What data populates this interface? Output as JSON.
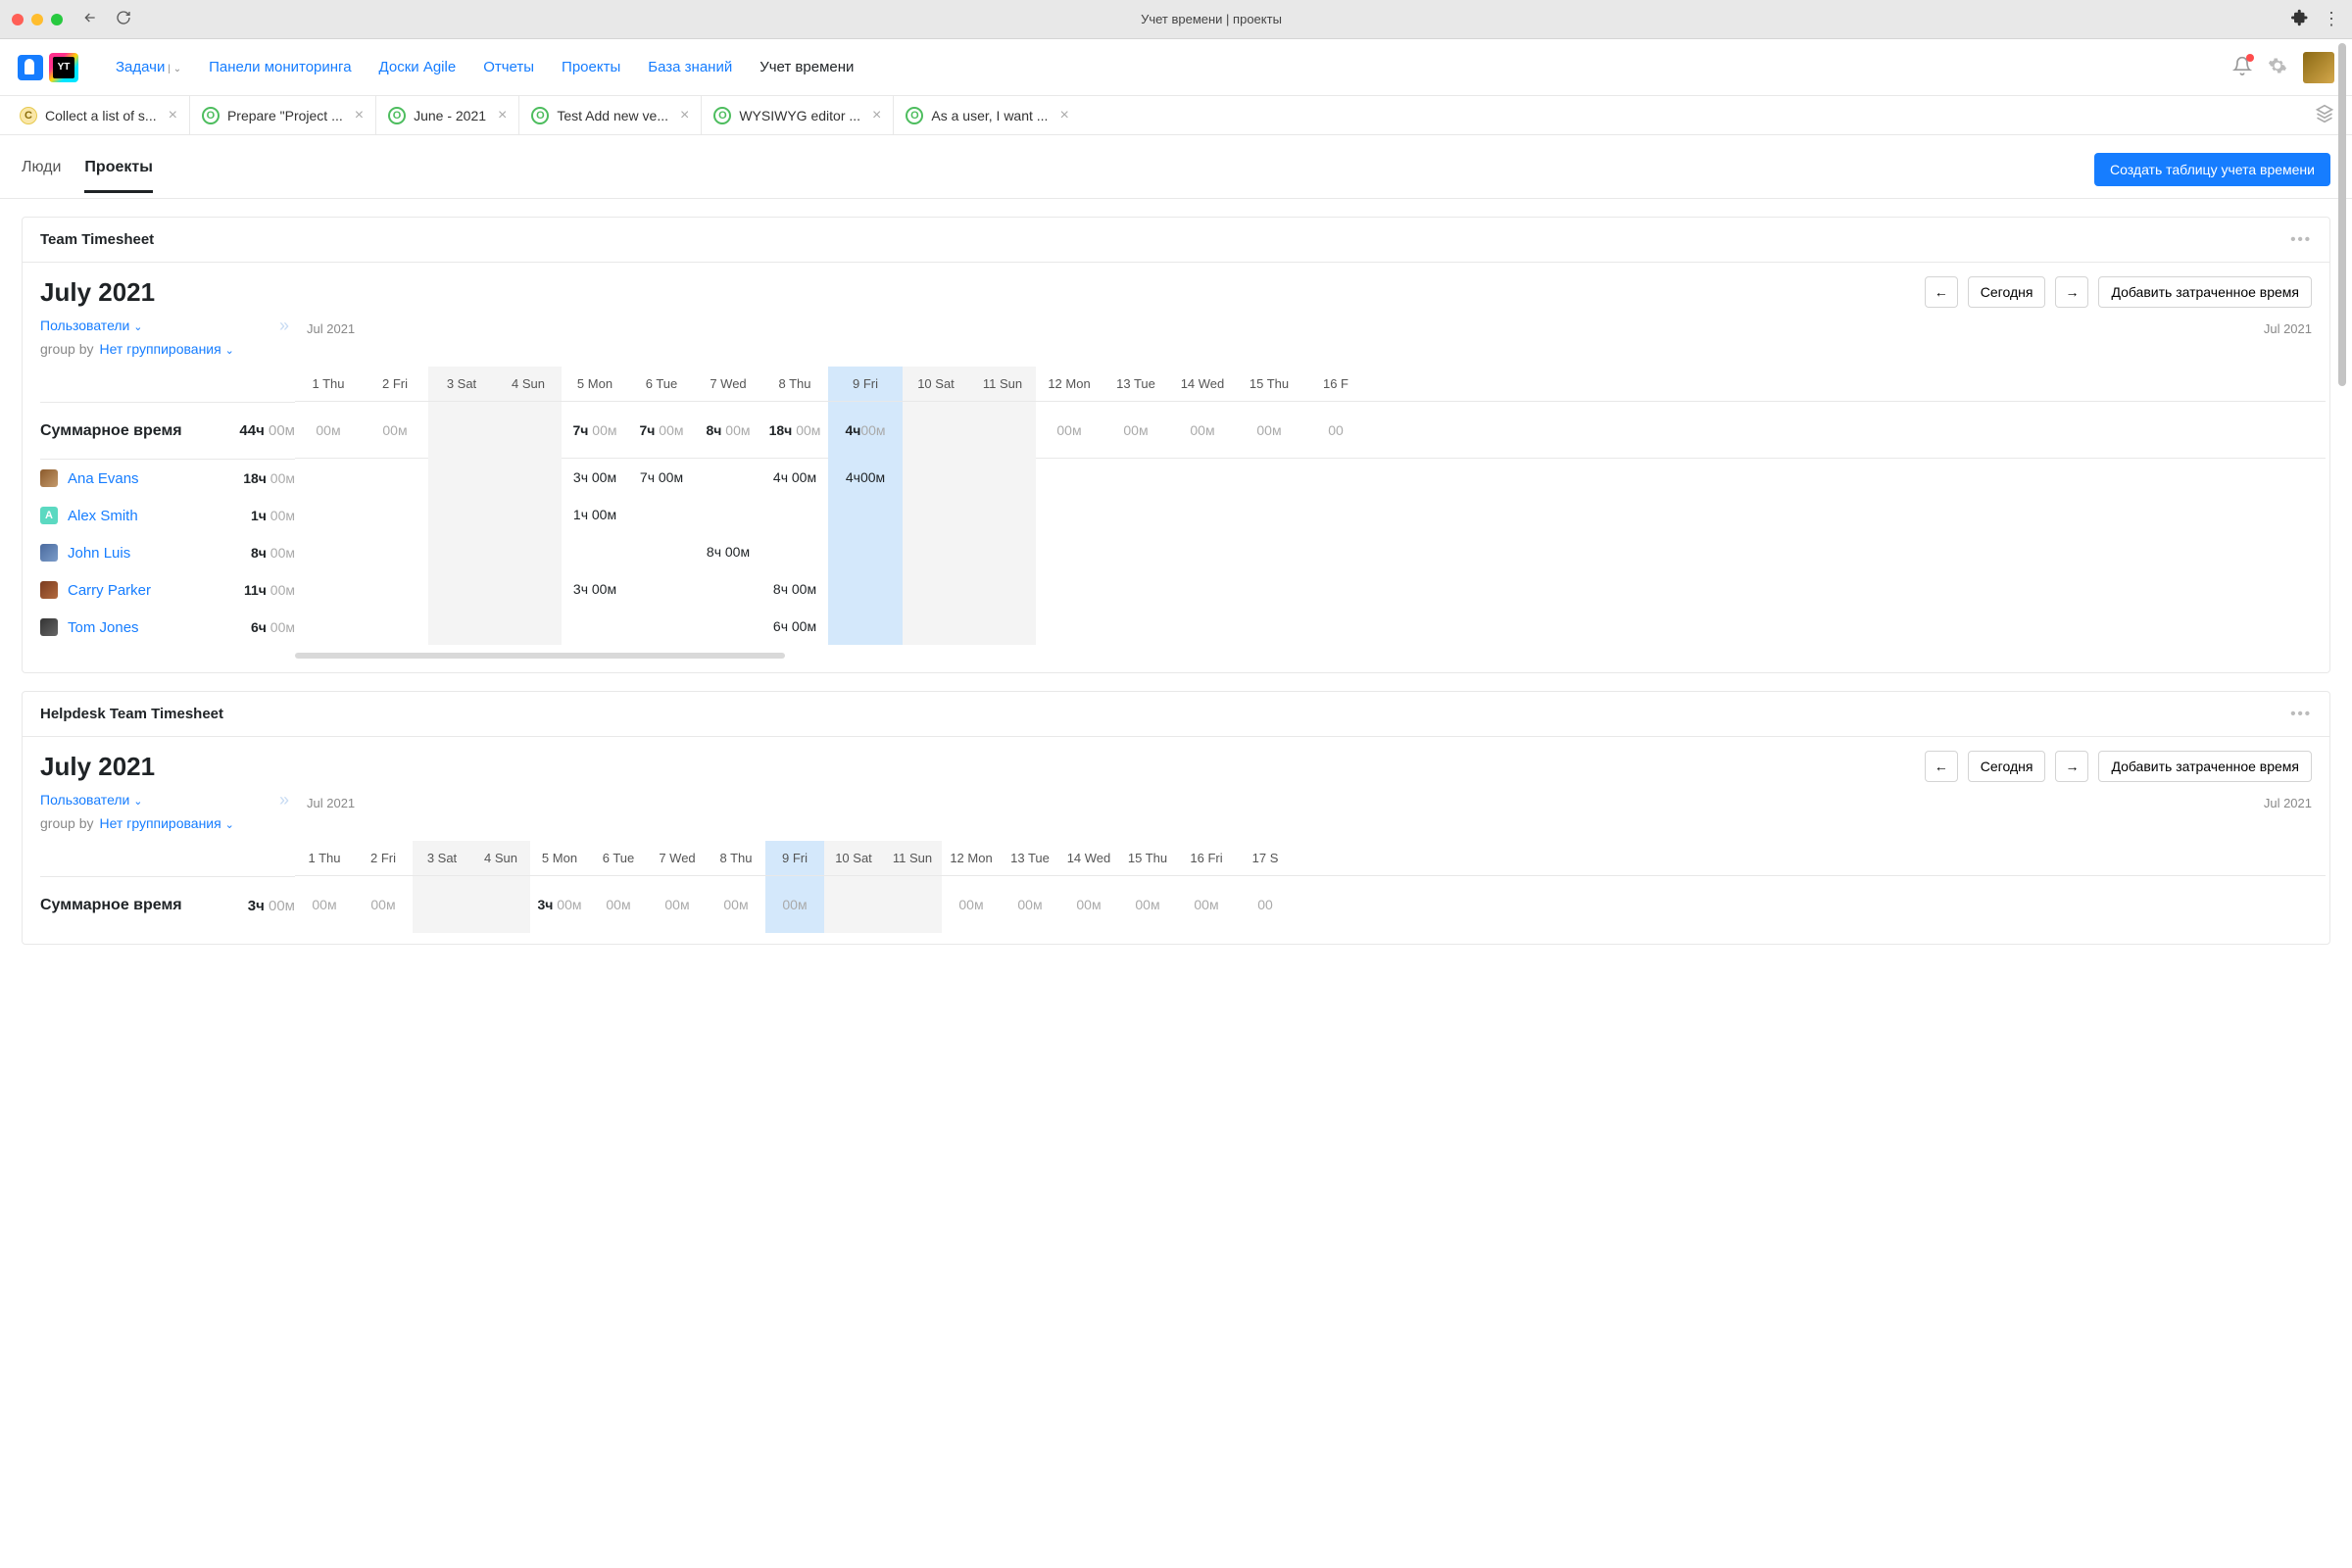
{
  "chrome": {
    "title": "Учет времени | проекты"
  },
  "nav": {
    "items": [
      {
        "label": "Задачи",
        "has_caret": true
      },
      {
        "label": "Панели мониторинга"
      },
      {
        "label": "Доски Agile"
      },
      {
        "label": "Отчеты"
      },
      {
        "label": "Проекты"
      },
      {
        "label": "База знаний"
      },
      {
        "label": "Учет времени",
        "active": true
      }
    ]
  },
  "logo_text": "YT",
  "breadcrumb_tabs": [
    {
      "icon": "C",
      "cls": "c",
      "label": "Collect a list of s..."
    },
    {
      "icon": "O",
      "cls": "o",
      "label": "Prepare \"Project ..."
    },
    {
      "icon": "O",
      "cls": "o",
      "label": "June - 2021"
    },
    {
      "icon": "O",
      "cls": "o",
      "label": "Test Add new ve..."
    },
    {
      "icon": "O",
      "cls": "o",
      "label": "WYSIWYG editor ..."
    },
    {
      "icon": "O",
      "cls": "o",
      "label": "As a user, I want ..."
    }
  ],
  "view_tabs": {
    "people": "Люди",
    "projects": "Проекты",
    "create_btn": "Создать таблицу учета времени"
  },
  "common": {
    "today": "Сегодня",
    "add_time": "Добавить затраченное время",
    "users": "Пользователи",
    "group_by": "group by",
    "no_grouping": "Нет группирования",
    "period_left": "Jul 2021",
    "period_right": "Jul 2021",
    "sum_label": "Суммарное время"
  },
  "panel1": {
    "name": "Team Timesheet",
    "month": "July 2021",
    "columns": [
      {
        "label": "1 Thu",
        "type": ""
      },
      {
        "label": "2 Fri",
        "type": ""
      },
      {
        "label": "3 Sat",
        "type": "we"
      },
      {
        "label": "4 Sun",
        "type": "we"
      },
      {
        "label": "5 Mon",
        "type": ""
      },
      {
        "label": "6 Tue",
        "type": ""
      },
      {
        "label": "7 Wed",
        "type": ""
      },
      {
        "label": "8 Thu",
        "type": ""
      },
      {
        "label": "9 Fri",
        "type": "hl",
        "wide": true
      },
      {
        "label": "10 Sat",
        "type": "we"
      },
      {
        "label": "11 Sun",
        "type": "we"
      },
      {
        "label": "12 Mon",
        "type": ""
      },
      {
        "label": "13 Tue",
        "type": ""
      },
      {
        "label": "14 Wed",
        "type": ""
      },
      {
        "label": "15 Thu",
        "type": ""
      },
      {
        "label": "16 F",
        "type": ""
      }
    ],
    "total": {
      "h": "44ч",
      "m": "00м"
    },
    "sum_cells": [
      {
        "h": "",
        "m": "00м"
      },
      {
        "h": "",
        "m": "00м"
      },
      null,
      null,
      {
        "h": "7ч",
        "m": "00м"
      },
      {
        "h": "7ч",
        "m": "00м"
      },
      {
        "h": "8ч",
        "m": "00м"
      },
      {
        "h": "18ч",
        "m": "00м"
      },
      {
        "h": "4ч",
        "m": "00м"
      },
      null,
      null,
      {
        "h": "",
        "m": "00м"
      },
      {
        "h": "",
        "m": "00м"
      },
      {
        "h": "",
        "m": "00м"
      },
      {
        "h": "",
        "m": "00м"
      },
      {
        "h": "",
        "m": "00"
      }
    ],
    "users": [
      {
        "name": "Ana Evans",
        "avatar": "av1",
        "total": {
          "h": "18ч",
          "m": "00м"
        },
        "cells": [
          null,
          null,
          null,
          null,
          {
            "h": "3ч",
            "m": "00м"
          },
          {
            "h": "7ч",
            "m": "00м"
          },
          null,
          {
            "h": "4ч",
            "m": "00м"
          },
          {
            "h": "4ч",
            "m": "00м"
          },
          null,
          null,
          null,
          null,
          null,
          null,
          null
        ]
      },
      {
        "name": "Alex Smith",
        "avatar": "av2",
        "avatar_text": "A",
        "total": {
          "h": "1ч",
          "m": "00м"
        },
        "cells": [
          null,
          null,
          null,
          null,
          {
            "h": "1ч",
            "m": "00м"
          },
          null,
          null,
          null,
          null,
          null,
          null,
          null,
          null,
          null,
          null,
          null
        ]
      },
      {
        "name": "John Luis",
        "avatar": "av3",
        "total": {
          "h": "8ч",
          "m": "00м"
        },
        "cells": [
          null,
          null,
          null,
          null,
          null,
          null,
          {
            "h": "8ч",
            "m": "00м"
          },
          null,
          null,
          null,
          null,
          null,
          null,
          null,
          null,
          null
        ]
      },
      {
        "name": "Carry Parker",
        "avatar": "av4",
        "total": {
          "h": "11ч",
          "m": "00м"
        },
        "cells": [
          null,
          null,
          null,
          null,
          {
            "h": "3ч",
            "m": "00м"
          },
          null,
          null,
          {
            "h": "8ч",
            "m": "00м"
          },
          null,
          null,
          null,
          null,
          null,
          null,
          null,
          null
        ]
      },
      {
        "name": "Tom Jones",
        "avatar": "av5",
        "total": {
          "h": "6ч",
          "m": "00м"
        },
        "cells": [
          null,
          null,
          null,
          null,
          null,
          null,
          null,
          {
            "h": "6ч",
            "m": "00м"
          },
          null,
          null,
          null,
          null,
          null,
          null,
          null,
          null
        ]
      }
    ]
  },
  "panel2": {
    "name": "Helpdesk Team Timesheet",
    "month": "July 2021",
    "columns": [
      {
        "label": "1 Thu",
        "type": ""
      },
      {
        "label": "2 Fri",
        "type": ""
      },
      {
        "label": "3 Sat",
        "type": "we"
      },
      {
        "label": "4 Sun",
        "type": "we"
      },
      {
        "label": "5 Mon",
        "type": ""
      },
      {
        "label": "6 Tue",
        "type": ""
      },
      {
        "label": "7 Wed",
        "type": ""
      },
      {
        "label": "8 Thu",
        "type": ""
      },
      {
        "label": "9 Fri",
        "type": "hl"
      },
      {
        "label": "10 Sat",
        "type": "we"
      },
      {
        "label": "11 Sun",
        "type": "we"
      },
      {
        "label": "12 Mon",
        "type": ""
      },
      {
        "label": "13 Tue",
        "type": ""
      },
      {
        "label": "14 Wed",
        "type": ""
      },
      {
        "label": "15 Thu",
        "type": ""
      },
      {
        "label": "16 Fri",
        "type": ""
      },
      {
        "label": "17 S",
        "type": ""
      }
    ],
    "total": {
      "h": "3ч",
      "m": "00м"
    },
    "sum_cells": [
      {
        "m": "00м"
      },
      {
        "m": "00м"
      },
      null,
      null,
      {
        "h": "3ч",
        "m": "00м"
      },
      {
        "m": "00м"
      },
      {
        "m": "00м"
      },
      {
        "m": "00м"
      },
      {
        "m": "00м"
      },
      null,
      null,
      {
        "m": "00м"
      },
      {
        "m": "00м"
      },
      {
        "m": "00м"
      },
      {
        "m": "00м"
      },
      {
        "m": "00м"
      },
      {
        "m": "00"
      }
    ]
  }
}
